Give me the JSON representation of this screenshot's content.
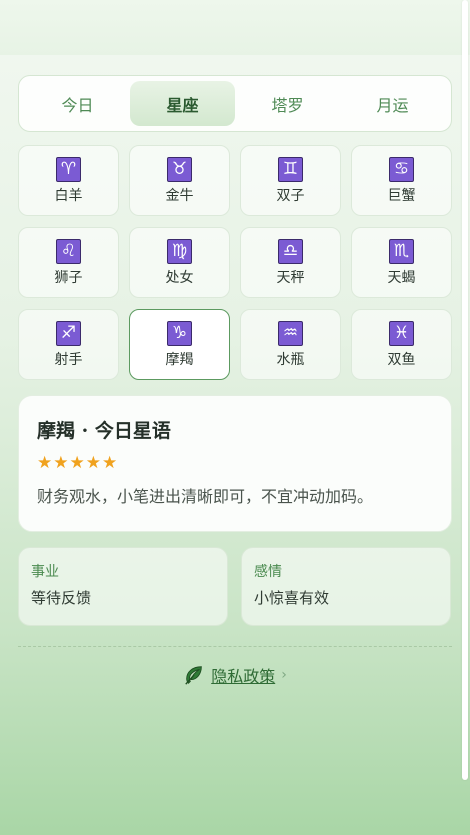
{
  "tabs": [
    {
      "label": "今日",
      "active": false
    },
    {
      "label": "星座",
      "active": true
    },
    {
      "label": "塔罗",
      "active": false
    },
    {
      "label": "月运",
      "active": false
    }
  ],
  "signs": [
    {
      "glyph": "♈",
      "label": "白羊",
      "selected": false
    },
    {
      "glyph": "♉",
      "label": "金牛",
      "selected": false
    },
    {
      "glyph": "♊",
      "label": "双子",
      "selected": false
    },
    {
      "glyph": "♋",
      "label": "巨蟹",
      "selected": false
    },
    {
      "glyph": "♌",
      "label": "狮子",
      "selected": false
    },
    {
      "glyph": "♍",
      "label": "处女",
      "selected": false
    },
    {
      "glyph": "♎",
      "label": "天秤",
      "selected": false
    },
    {
      "glyph": "♏",
      "label": "天蝎",
      "selected": false
    },
    {
      "glyph": "♐",
      "label": "射手",
      "selected": false
    },
    {
      "glyph": "♑",
      "label": "摩羯",
      "selected": true
    },
    {
      "glyph": "♒",
      "label": "水瓶",
      "selected": false
    },
    {
      "glyph": "♓",
      "label": "双鱼",
      "selected": false
    }
  ],
  "detail": {
    "title": "摩羯 · 今日星语",
    "rating": 5,
    "stars_text": "★★★★★",
    "message": "财务观水，小笔进出清晰即可，不宜冲动加码。"
  },
  "career": {
    "label": "事业",
    "value": "等待反馈"
  },
  "love": {
    "label": "感情",
    "value": "小惊喜有效"
  },
  "footer": {
    "privacy_label": "隐私政策",
    "chevron": "›"
  },
  "colors": {
    "accent": "#4f8a55",
    "glyph_bg": "#7b5bd3",
    "star": "#f0a21e"
  }
}
